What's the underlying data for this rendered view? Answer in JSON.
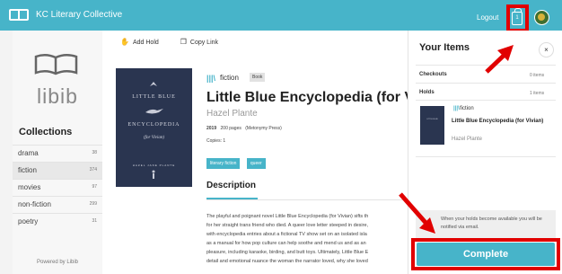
{
  "header": {
    "brand": "KC Literary Collective",
    "logout": "Logout",
    "cart_count": "1"
  },
  "sidebar": {
    "logo_text": "libib",
    "collections_title": "Collections",
    "collections": [
      {
        "name": "drama",
        "count": "38"
      },
      {
        "name": "fiction",
        "count": "374"
      },
      {
        "name": "movies",
        "count": "97"
      },
      {
        "name": "non-fiction",
        "count": "299"
      },
      {
        "name": "poetry",
        "count": "31"
      }
    ],
    "powered_by": "Powered by Libib"
  },
  "toolbar": {
    "add_hold": "Add Hold",
    "copy_link": "Copy Link"
  },
  "book": {
    "collection": "fiction",
    "type_badge": "Book",
    "title": "Little Blue Encyclopedia (for Vivi",
    "author": "Hazel Plante",
    "year": "2019",
    "pages": "200 pages",
    "publisher": "(Metonymy Press)",
    "copies": "Copies: 1",
    "tags": [
      "literary fiction",
      "queer"
    ],
    "cover": {
      "line1": "LITTLE BLUE",
      "line2": "ENCYCLOPEDIA",
      "line3": "(for Vivian)",
      "author": "HAZEL JANE PLANTE"
    },
    "description_heading": "Description",
    "description_lines": [
      "The playful and poignant novel Little Blue Encyclopedia (for Vivian) sifts th",
      "for her straight trans friend who died. A queer love letter steeped in desire,",
      "with encyclopedia entries about a fictional TV show set on an isolated isla",
      "as a manual for how pop culture can help soothe and mend us and as an",
      "pleasure, including karaoke, birding, and butt toys. Ultimately, Little Blue E",
      "detail and emotional nuance the woman the narrator loved, why she loved"
    ]
  },
  "panel": {
    "title": "Your Items",
    "close": "×",
    "checkouts_label": "Checkouts",
    "checkouts_count": "0 items",
    "holds_label": "Holds",
    "holds_count": "1 items",
    "item": {
      "kind": "fiction",
      "title": "Little Blue Encyclopedia (for Vivian)",
      "author": "Hazel Plante",
      "cover_text": "LITTLE BLUE"
    },
    "notice": "When your holds become available you will be notified via email.",
    "complete_button": "Complete"
  },
  "colors": {
    "accent": "#47b4c9",
    "highlight": "#e10000",
    "cover": "#2a3550"
  },
  "icons": [
    "book-icon",
    "shopping-bag-icon",
    "avatar",
    "hold-icon",
    "copy-icon",
    "close-icon"
  ]
}
